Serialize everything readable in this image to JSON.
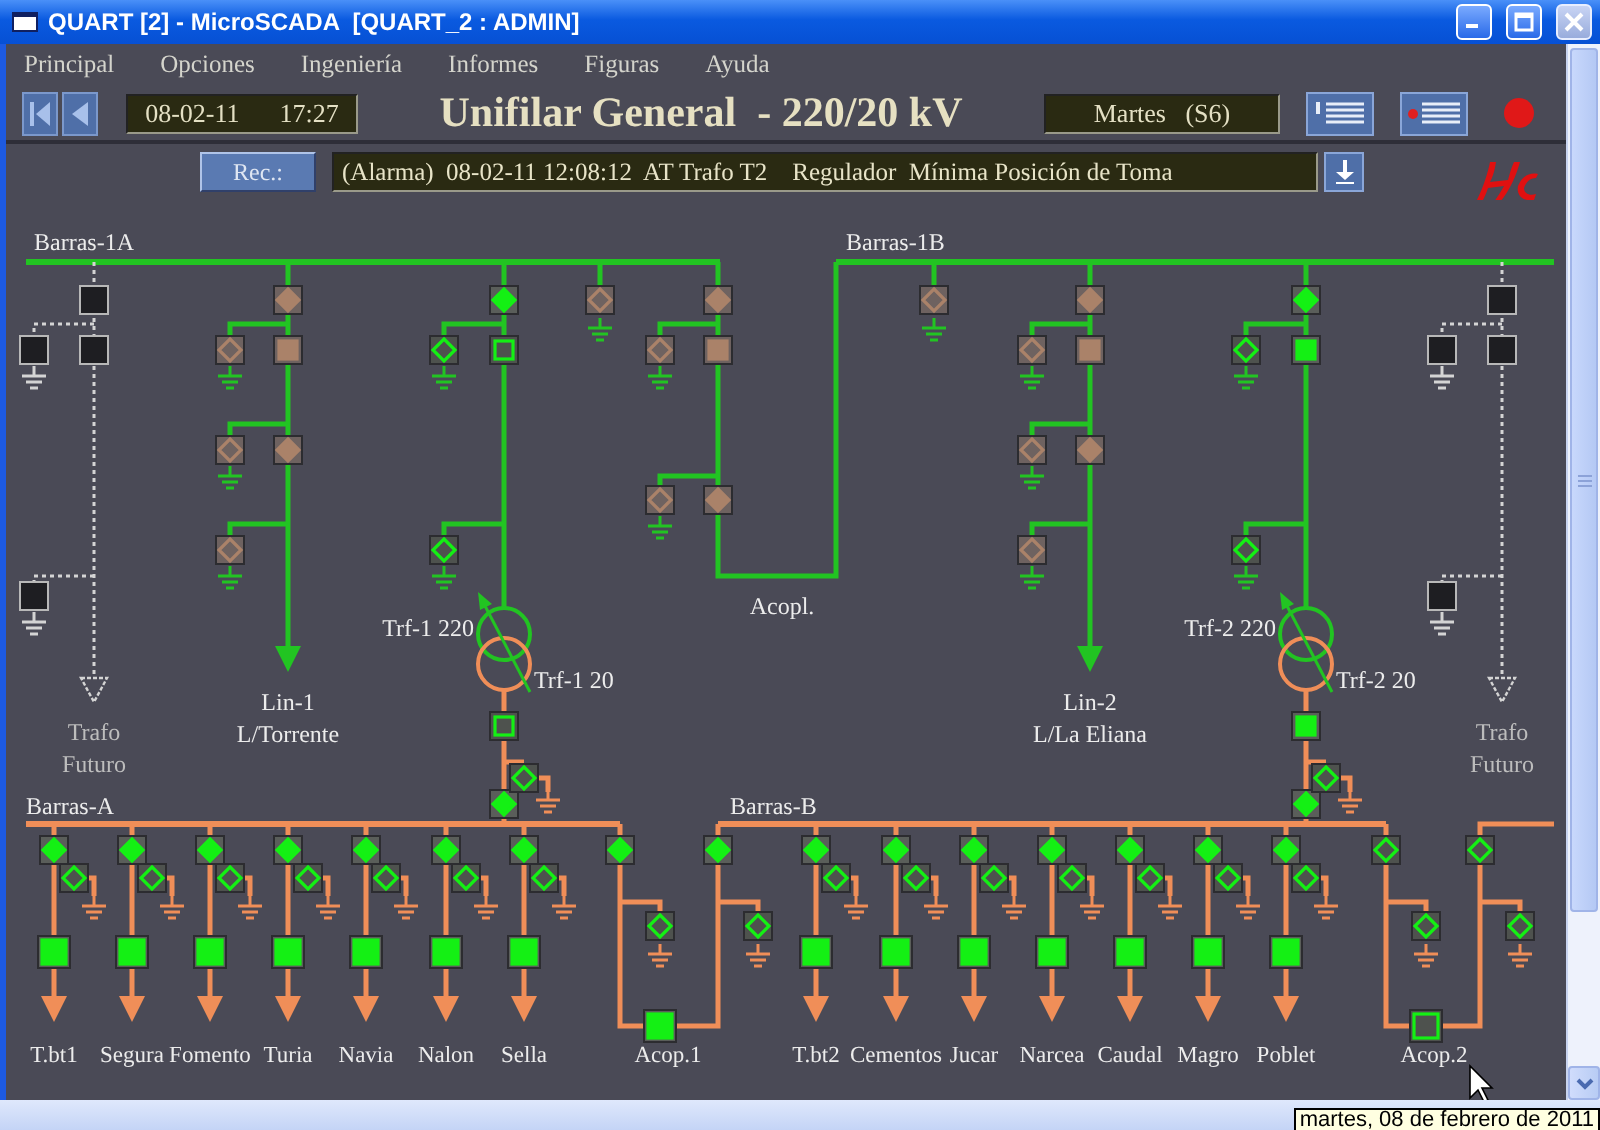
{
  "window": {
    "title": "QUART [2] - MicroSCADA  [QUART_2 : ADMIN]"
  },
  "menu": [
    "Principal",
    "Opciones",
    "Ingeniería",
    "Informes",
    "Figuras",
    "Ayuda"
  ],
  "toolbar": {
    "date": "08-02-11",
    "time": "17:27",
    "title": "Unifilar General  - 220/20 kV",
    "day": "Martes   (S6)"
  },
  "alarm": {
    "button": "Rec.:",
    "message": "(Alarma)  08-02-11 12:08:12  AT Trafo T2    Regulador  Mínima Posición de Toma"
  },
  "diagram": {
    "hv_buses": [
      {
        "label": "Barras-1A"
      },
      {
        "label": "Barras-1B"
      }
    ],
    "hv_bays": [
      {
        "kind": "future",
        "label_lines": [
          "Trafo",
          "Futuro"
        ]
      },
      {
        "kind": "line",
        "label_lines": [
          "Lin-1",
          "L/Torrente"
        ],
        "switches": [
          {
            "closed": true,
            "valid": false
          },
          {
            "closed": true,
            "valid": false
          },
          {
            "closed": false,
            "valid": false
          },
          {
            "closed": false,
            "valid": false
          },
          {
            "closed": true,
            "valid": false
          },
          {
            "closed": false,
            "valid": false
          }
        ]
      },
      {
        "kind": "transformer",
        "hv_label": "Trf-1 220",
        "mv_label": "Trf-1 20",
        "switches": [
          {
            "closed": true,
            "valid": true
          },
          {
            "closed": false,
            "valid": true
          },
          {
            "closed": false,
            "valid": true
          },
          {
            "closed": false,
            "valid": true
          },
          {
            "closed": false,
            "valid": true
          },
          {
            "closed": true,
            "valid": true
          },
          {
            "closed": false,
            "valid": true
          }
        ]
      },
      {
        "kind": "earth",
        "switches": [
          {
            "closed": false,
            "valid": false
          }
        ]
      },
      {
        "kind": "coupler",
        "label_lines": [
          "Acopl."
        ],
        "switches": [
          {
            "closed": true,
            "valid": false
          },
          {
            "closed": true,
            "valid": false
          },
          {
            "closed": false,
            "valid": false
          },
          {
            "closed": false,
            "valid": false
          },
          {
            "closed": true,
            "valid": false
          }
        ]
      },
      {
        "kind": "earth",
        "switches": [
          {
            "closed": false,
            "valid": false
          }
        ]
      },
      {
        "kind": "line",
        "label_lines": [
          "Lin-2",
          "L/La Eliana"
        ],
        "switches": [
          {
            "closed": true,
            "valid": false
          },
          {
            "closed": true,
            "valid": false
          },
          {
            "closed": false,
            "valid": false
          },
          {
            "closed": false,
            "valid": false
          },
          {
            "closed": true,
            "valid": false
          },
          {
            "closed": false,
            "valid": false
          }
        ]
      },
      {
        "kind": "transformer",
        "hv_label": "Trf-2 220",
        "mv_label": "Trf-2 20",
        "switches": [
          {
            "closed": true,
            "valid": true
          },
          {
            "closed": true,
            "valid": true
          },
          {
            "closed": false,
            "valid": true
          },
          {
            "closed": false,
            "valid": true
          },
          {
            "closed": true,
            "valid": true
          },
          {
            "closed": true,
            "valid": true
          },
          {
            "closed": false,
            "valid": true
          }
        ]
      },
      {
        "kind": "future",
        "label_lines": [
          "Trafo",
          "Futuro"
        ]
      }
    ],
    "mv_buses": [
      {
        "label": "Barras-A"
      },
      {
        "label": "Barras-B"
      }
    ],
    "mv_feeders": [
      {
        "label": "T.bt1",
        "switches": [
          {
            "closed": true
          },
          {
            "closed": false
          },
          {
            "closed": true
          }
        ]
      },
      {
        "label": "Segura",
        "switches": [
          {
            "closed": true
          },
          {
            "closed": false
          },
          {
            "closed": true
          }
        ]
      },
      {
        "label": "Fomento",
        "switches": [
          {
            "closed": true
          },
          {
            "closed": false
          },
          {
            "closed": true
          }
        ]
      },
      {
        "label": "Turia",
        "switches": [
          {
            "closed": true
          },
          {
            "closed": false
          },
          {
            "closed": true
          }
        ]
      },
      {
        "label": "Navia",
        "switches": [
          {
            "closed": true
          },
          {
            "closed": false
          },
          {
            "closed": true
          }
        ]
      },
      {
        "label": "Nalon",
        "switches": [
          {
            "closed": true
          },
          {
            "closed": false
          },
          {
            "closed": true
          }
        ]
      },
      {
        "label": "Sella",
        "switches": [
          {
            "closed": true
          },
          {
            "closed": false
          },
          {
            "closed": true
          }
        ]
      },
      {
        "label": "T.bt2",
        "switches": [
          {
            "closed": true
          },
          {
            "closed": false
          },
          {
            "closed": true
          }
        ]
      },
      {
        "label": "Cementos",
        "switches": [
          {
            "closed": true
          },
          {
            "closed": false
          },
          {
            "closed": true
          }
        ]
      },
      {
        "label": "Jucar",
        "switches": [
          {
            "closed": true
          },
          {
            "closed": false
          },
          {
            "closed": true
          }
        ]
      },
      {
        "label": "Narcea",
        "switches": [
          {
            "closed": true
          },
          {
            "closed": false
          },
          {
            "closed": true
          }
        ]
      },
      {
        "label": "Caudal",
        "switches": [
          {
            "closed": true
          },
          {
            "closed": false
          },
          {
            "closed": true
          }
        ]
      },
      {
        "label": "Magro",
        "switches": [
          {
            "closed": true
          },
          {
            "closed": false
          },
          {
            "closed": true
          }
        ]
      },
      {
        "label": "Poblet",
        "switches": [
          {
            "closed": true
          },
          {
            "closed": false
          },
          {
            "closed": true
          }
        ]
      }
    ],
    "mv_couplers": [
      {
        "label": "Acop.1",
        "switches": [
          {
            "closed": true
          },
          {
            "closed": false
          },
          {
            "closed": true
          },
          {
            "closed": true
          },
          {
            "closed": false
          }
        ]
      },
      {
        "label": "Acop.2",
        "switches": [
          {
            "closed": false
          },
          {
            "closed": false
          },
          {
            "closed": false
          },
          {
            "closed": false
          },
          {
            "closed": false
          }
        ]
      }
    ]
  },
  "tooltip": "martes, 08 de febrero de 2011"
}
